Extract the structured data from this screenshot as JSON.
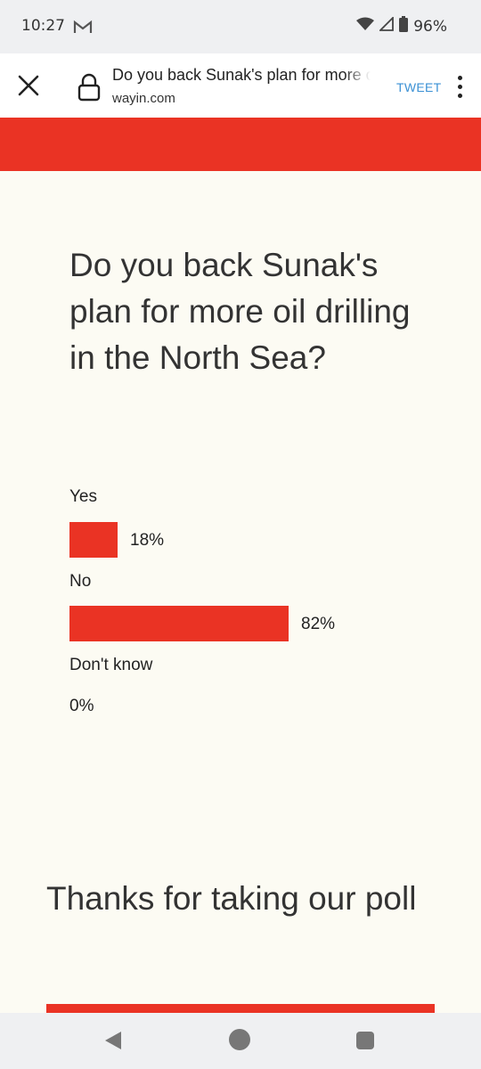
{
  "status_bar": {
    "time": "10:27",
    "mail_icon": "gmail-icon",
    "battery": "96%",
    "icons": [
      "wifi-icon",
      "signal-icon",
      "battery-icon"
    ]
  },
  "browser": {
    "page_title": "Do you back Sunak's plan for more oil drilling in the North Sea?",
    "domain": "wayin.com",
    "tweet_label": "TWEET",
    "icons": [
      "close-icon",
      "lock-icon",
      "more-vert-icon"
    ]
  },
  "poll": {
    "question": "Do you back Sunak's plan for more oil drilling in the North Sea?",
    "options": [
      {
        "label": "Yes",
        "percent_label": "18%",
        "value": 18
      },
      {
        "label": "No",
        "percent_label": "82%",
        "value": 82
      },
      {
        "label": "Don't know",
        "percent_label": "0%",
        "value": 0
      }
    ],
    "thanks": "Thanks for taking our poll"
  },
  "colors": {
    "accent": "#ea3324",
    "background": "#fcfbf3",
    "tweet": "#3a90d4"
  },
  "nav": {
    "icons": [
      "back-icon",
      "home-icon",
      "recents-icon"
    ]
  }
}
